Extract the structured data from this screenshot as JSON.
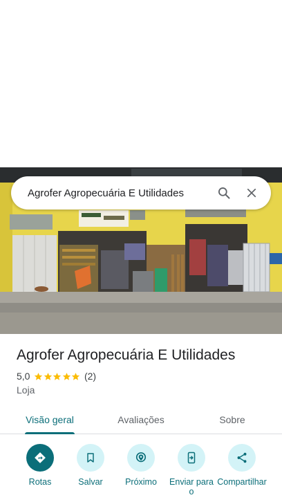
{
  "search": {
    "query": "Agrofer Agropecuária E Utilidades",
    "search_icon": "search-icon",
    "close_icon": "close-icon"
  },
  "photo": {
    "icon": "storefront-photo"
  },
  "place": {
    "name": "Agrofer Agropecuária E Utilidades",
    "rating": "5,0",
    "stars": 5,
    "review_count": "(2)",
    "category": "Loja"
  },
  "tabs": [
    {
      "label": "Visão geral",
      "active": true
    },
    {
      "label": "Avaliações",
      "active": false
    },
    {
      "label": "Sobre",
      "active": false
    }
  ],
  "actions": [
    {
      "label": "Rotas",
      "icon": "directions-icon"
    },
    {
      "label": "Salvar",
      "icon": "bookmark-icon"
    },
    {
      "label": "Próximo",
      "icon": "nearby-icon"
    },
    {
      "label": "Enviar para o",
      "icon": "send-to-phone-icon"
    },
    {
      "label": "Compartilhar",
      "icon": "share-icon"
    }
  ],
  "colors": {
    "accent": "#0b6e79",
    "accent_light": "#d3f3f7",
    "star": "#fbbc04"
  }
}
